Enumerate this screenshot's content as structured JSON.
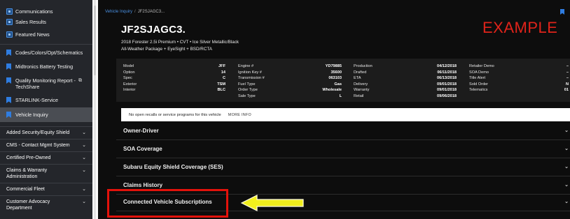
{
  "sidebar": {
    "items": [
      {
        "label": "Communications",
        "icon": "message-icon"
      },
      {
        "label": "Sales Results",
        "icon": "chart-icon"
      },
      {
        "label": "Featured News",
        "icon": "news-icon"
      },
      {
        "label": "Codes/Colors/Opt/Schematics",
        "icon": "bookmark-icon"
      },
      {
        "label": "Midtronics Battery Testing",
        "icon": "bookmark-icon"
      },
      {
        "label": "Quality Monitoring Report - TechShare",
        "icon": "bookmark-icon"
      },
      {
        "label": "STARLINK-Service",
        "icon": "bookmark-icon"
      },
      {
        "label": "Vehicle Inquiry",
        "icon": "bookmark-icon"
      }
    ],
    "categories": [
      {
        "label": "Added Security/Equity Shield"
      },
      {
        "label": "CMS - Contact Mgmt System"
      },
      {
        "label": "Certified Pre-Owned"
      },
      {
        "label": "Claims & Warranty Administration"
      },
      {
        "label": "Commercial Fleet"
      },
      {
        "label": "Customer Advocacy Department"
      }
    ]
  },
  "breadcrumb": {
    "root": "Vehicle Inquiry",
    "separator": "/",
    "current": "JF2SJAGC3..."
  },
  "vehicle": {
    "vin": "JF2SJAGC3.",
    "line1": "2018 Forester 2.5i Premium • CVT • Ice Silver Metallic/Black",
    "line2": "All-Weather Package + EyeSight + BSD/RCTA"
  },
  "watermark": "EXAMPLE",
  "details": {
    "col1": [
      {
        "label": "Model",
        "value": "JFF"
      },
      {
        "label": "Option",
        "value": "14"
      },
      {
        "label": "Spec",
        "value": "C"
      },
      {
        "label": "Exterior",
        "value": "TSM"
      },
      {
        "label": "Interior",
        "value": "BLC"
      }
    ],
    "col2": [
      {
        "label": "Engine #",
        "value": "YD79885"
      },
      {
        "label": "Ignition Key #",
        "value": "35600"
      },
      {
        "label": "Transmission #",
        "value": "063103"
      },
      {
        "label": "Fuel Type",
        "value": "Gas"
      },
      {
        "label": "Order Type",
        "value": "Wholesale"
      },
      {
        "label": "Sale Type",
        "value": "L"
      }
    ],
    "col3": [
      {
        "label": "Production",
        "value": "04/12/2018"
      },
      {
        "label": "Drafted",
        "value": "06/11/2018"
      },
      {
        "label": "ETA",
        "value": "06/13/2018"
      },
      {
        "label": "Delivery",
        "value": "09/01/2018"
      },
      {
        "label": "Warranty",
        "value": "09/01/2018"
      },
      {
        "label": "Retail",
        "value": "09/06/2018"
      }
    ],
    "col4": [
      {
        "label": "Retailer Demo",
        "value": "–"
      },
      {
        "label": "SOA Demo",
        "value": "–"
      },
      {
        "label": "Title Alert",
        "value": "–"
      },
      {
        "label": "Sold Order",
        "value": "N"
      },
      {
        "label": "Telematics",
        "value": "01"
      }
    ]
  },
  "recall": {
    "text": "No open recalls or service programs for this vehicle",
    "link": "MORE INFO"
  },
  "accordion": [
    {
      "label": "Owner-Driver"
    },
    {
      "label": "SOA Coverage"
    },
    {
      "label": "Subaru Equity Shield Coverage (SES)"
    },
    {
      "label": "Claims History"
    },
    {
      "label": "Connected Vehicle Subscriptions"
    }
  ],
  "colors": {
    "sidebar_bg": "#24262b",
    "main_bg": "#0d0d0d",
    "accent_blue": "#2f7de1",
    "highlight_red": "#e3120b",
    "arrow_yellow": "#f2ef1d"
  }
}
